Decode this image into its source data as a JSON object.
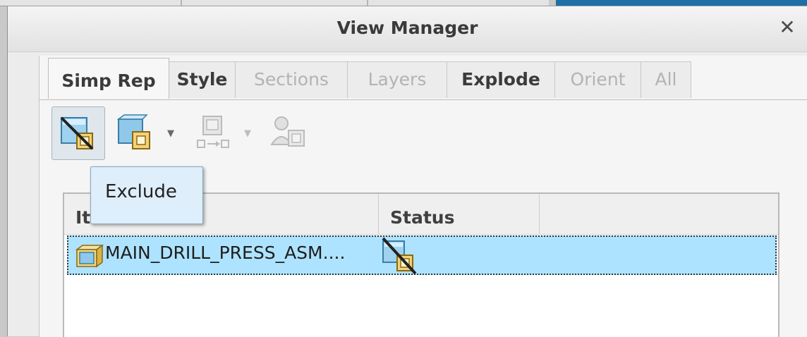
{
  "dialog": {
    "title": "View Manager",
    "close_glyph": "✕"
  },
  "tabs": [
    {
      "label": "Simp Rep",
      "active": true,
      "enabled": true
    },
    {
      "label": "Style",
      "active": false,
      "enabled": true
    },
    {
      "label": "Sections",
      "active": false,
      "enabled": false
    },
    {
      "label": "Layers",
      "active": false,
      "enabled": false
    },
    {
      "label": "Explode",
      "active": false,
      "enabled": true
    },
    {
      "label": "Orient",
      "active": false,
      "enabled": false
    },
    {
      "label": "All",
      "active": false,
      "enabled": false
    }
  ],
  "toolbar": {
    "tools": [
      {
        "icon": "exclude-icon",
        "pressed": true,
        "enabled": true
      },
      {
        "icon": "include-icon",
        "pressed": false,
        "enabled": true,
        "has_dropdown": true
      },
      {
        "icon": "substitute-icon",
        "pressed": false,
        "enabled": false,
        "has_dropdown": true
      },
      {
        "icon": "user-defined-icon",
        "pressed": false,
        "enabled": false
      }
    ]
  },
  "tooltip": {
    "text": "Exclude"
  },
  "tree": {
    "columns": [
      "Item",
      "Status",
      ""
    ],
    "rows": [
      {
        "name": "MAIN_DRILL_PRESS_ASM....",
        "icon": "assembly-icon",
        "status_icon": "exclude-icon",
        "selected": true
      }
    ]
  },
  "colors": {
    "selection": "#aee3ff",
    "tooltip_bg": "#deeefa",
    "accent_strip": "#1d6fa5"
  }
}
